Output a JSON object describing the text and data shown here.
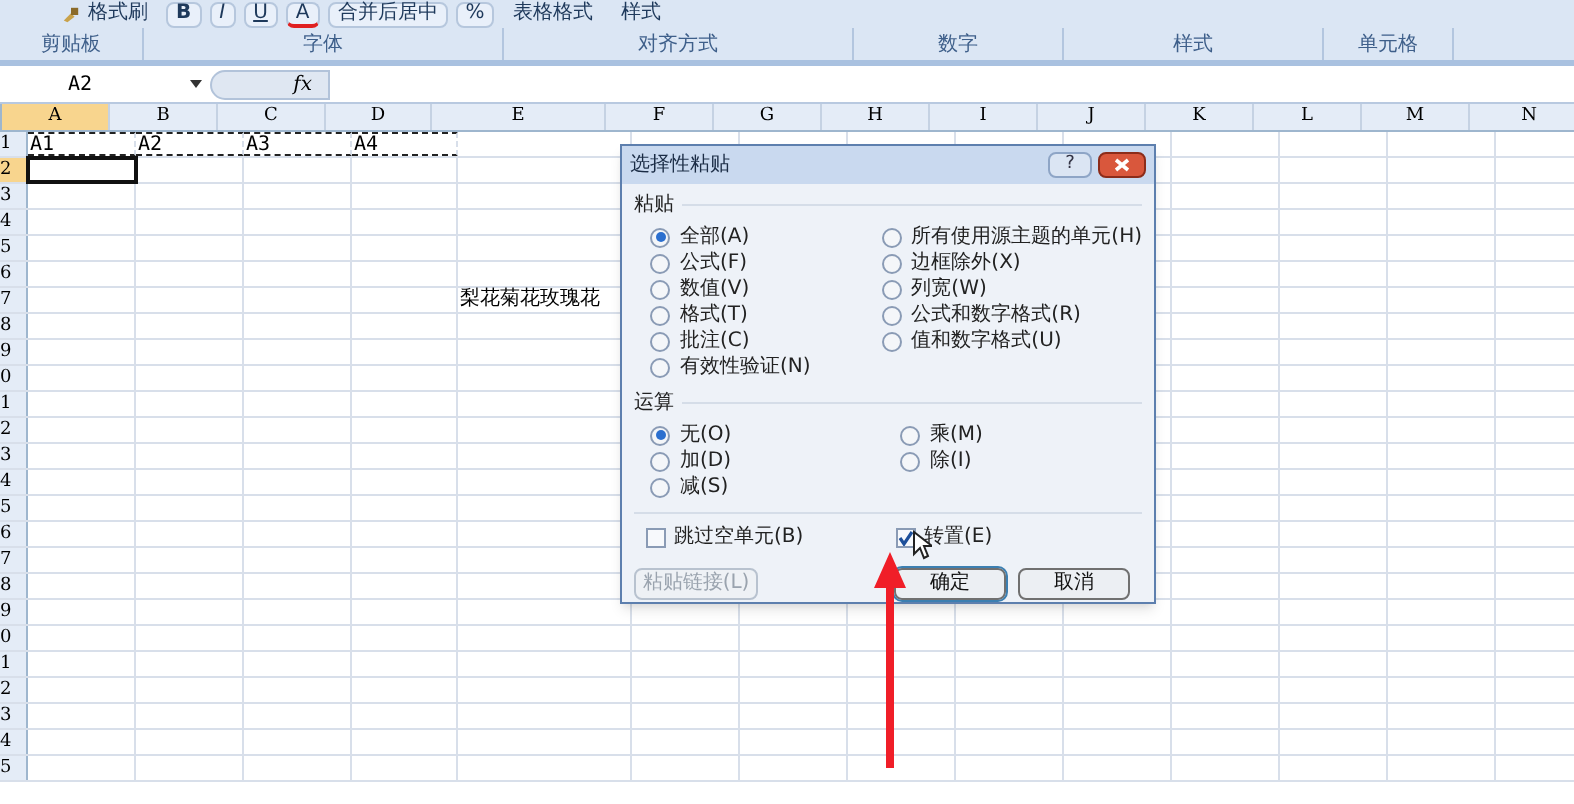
{
  "ribbon": {
    "buttons": [
      {
        "label": "格式刷",
        "kind": "brush"
      },
      {
        "label": "B",
        "kind": "bold"
      },
      {
        "label": "I",
        "kind": "italic"
      },
      {
        "label": "U",
        "kind": "underline"
      },
      {
        "label": "A",
        "kind": "fontcolor"
      },
      {
        "label": "合并后居中",
        "kind": "merge"
      },
      {
        "label": "%",
        "kind": "plain"
      },
      {
        "label": "表格格式",
        "kind": "menu"
      },
      {
        "label": "样式",
        "kind": "menu"
      }
    ],
    "groups": [
      {
        "label": "剪贴板"
      },
      {
        "label": "字体"
      },
      {
        "label": "对齐方式"
      },
      {
        "label": "数字"
      },
      {
        "label": "样式"
      },
      {
        "label": "单元格"
      }
    ]
  },
  "formula_bar": {
    "name_box": "A2",
    "function_label": "fx"
  },
  "sheet": {
    "columns": [
      {
        "label": "A",
        "selected": true
      },
      {
        "label": "B",
        "selected": false
      },
      {
        "label": "C",
        "selected": false
      },
      {
        "label": "D",
        "selected": false
      },
      {
        "label": "E",
        "selected": false
      },
      {
        "label": "F",
        "selected": false
      },
      {
        "label": "G",
        "selected": false
      },
      {
        "label": "H",
        "selected": false
      },
      {
        "label": "I",
        "selected": false
      },
      {
        "label": "J",
        "selected": false
      },
      {
        "label": "K",
        "selected": false
      },
      {
        "label": "L",
        "selected": false
      },
      {
        "label": "M",
        "selected": false
      },
      {
        "label": "N",
        "selected": false
      }
    ],
    "rows": [
      {
        "label": "1",
        "selected": false,
        "copied": true,
        "cells": [
          "A1",
          "A2",
          "A3",
          "A4"
        ]
      },
      {
        "label": "2",
        "selected": true
      },
      {
        "label": "3",
        "selected": false
      },
      {
        "label": "4",
        "selected": false
      },
      {
        "label": "5",
        "selected": false
      },
      {
        "label": "6",
        "selected": false
      },
      {
        "label": "7",
        "selected": false,
        "cells": [
          null,
          null,
          null,
          null,
          "梨花菊花玫瑰花"
        ]
      },
      {
        "label": "8",
        "selected": false
      },
      {
        "label": "9",
        "selected": false
      },
      {
        "label": "0",
        "selected": false
      },
      {
        "label": "1",
        "selected": false
      },
      {
        "label": "2",
        "selected": false
      },
      {
        "label": "3",
        "selected": false
      },
      {
        "label": "4",
        "selected": false
      },
      {
        "label": "5",
        "selected": false
      },
      {
        "label": "6",
        "selected": false
      },
      {
        "label": "7",
        "selected": false
      },
      {
        "label": "8",
        "selected": false
      },
      {
        "label": "9",
        "selected": false
      },
      {
        "label": "0",
        "selected": false
      },
      {
        "label": "1",
        "selected": false
      },
      {
        "label": "2",
        "selected": false
      },
      {
        "label": "3",
        "selected": false
      },
      {
        "label": "4",
        "selected": false
      },
      {
        "label": "5",
        "selected": false
      }
    ]
  },
  "dialog": {
    "title": "选择性粘贴",
    "help": "?",
    "paste": {
      "label": "粘贴",
      "columns": [
        {
          "options": [
            {
              "label": "全部(A)",
              "selected": true
            },
            {
              "label": "公式(F)",
              "selected": false
            },
            {
              "label": "数值(V)",
              "selected": false
            },
            {
              "label": "格式(T)",
              "selected": false
            },
            {
              "label": "批注(C)",
              "selected": false
            },
            {
              "label": "有效性验证(N)",
              "selected": false
            }
          ]
        },
        {
          "options": [
            {
              "label": "所有使用源主题的单元(H)",
              "selected": false
            },
            {
              "label": "边框除外(X)",
              "selected": false
            },
            {
              "label": "列宽(W)",
              "selected": false
            },
            {
              "label": "公式和数字格式(R)",
              "selected": false
            },
            {
              "label": "值和数字格式(U)",
              "selected": false
            }
          ]
        }
      ]
    },
    "operation": {
      "label": "运算",
      "columns": [
        {
          "options": [
            {
              "label": "无(O)",
              "selected": true
            },
            {
              "label": "加(D)",
              "selected": false
            },
            {
              "label": "减(S)",
              "selected": false
            }
          ]
        },
        {
          "options": [
            {
              "label": "乘(M)",
              "selected": false
            },
            {
              "label": "除(I)",
              "selected": false
            }
          ]
        }
      ]
    },
    "checkboxes": [
      {
        "label": "跳过空单元(B)",
        "checked": false
      },
      {
        "label": "转置(E)",
        "checked": true
      }
    ],
    "buttons": [
      {
        "label": "粘贴链接(L)",
        "disabled": true,
        "default": false
      },
      {
        "label": "确定",
        "disabled": false,
        "default": true
      },
      {
        "label": "取消",
        "disabled": false,
        "default": false
      }
    ]
  }
}
